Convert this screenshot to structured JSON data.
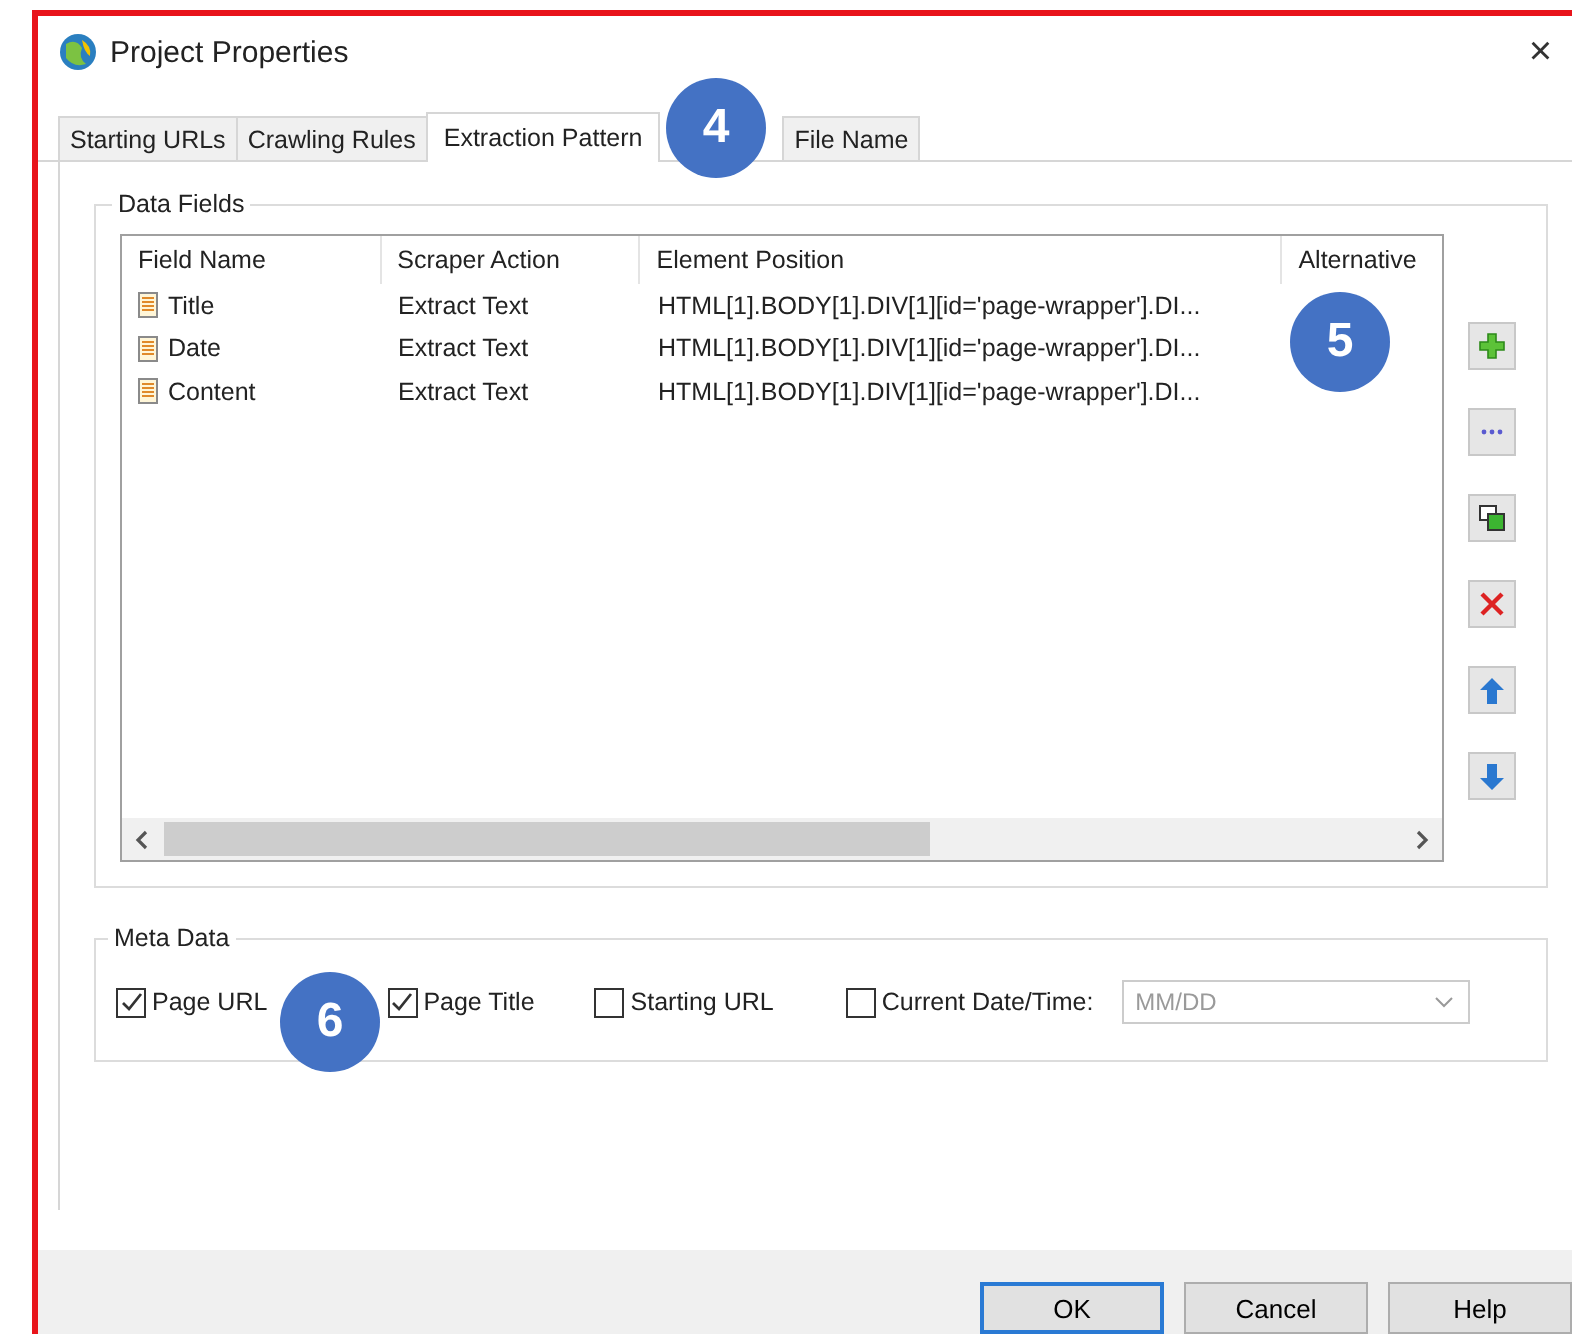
{
  "window": {
    "title": "Project Properties",
    "close": "×"
  },
  "tabs": [
    {
      "label": "Starting URLs",
      "selected": false
    },
    {
      "label": "Crawling Rules",
      "selected": false
    },
    {
      "label": "Extraction Pattern",
      "selected": true
    },
    {
      "label": "File Name",
      "selected": false
    }
  ],
  "data_fields": {
    "title": "Data Fields",
    "columns": [
      "Field Name",
      "Scraper Action",
      "Element Position",
      "Alternative"
    ],
    "rows": [
      {
        "name": "Title",
        "action": "Extract Text",
        "position": "HTML[1].BODY[1].DIV[1][id='page-wrapper'].DI..."
      },
      {
        "name": "Date",
        "action": "Extract Text",
        "position": "HTML[1].BODY[1].DIV[1][id='page-wrapper'].DI..."
      },
      {
        "name": "Content",
        "action": "Extract Text",
        "position": "HTML[1].BODY[1].DIV[1][id='page-wrapper'].DI..."
      }
    ],
    "side_buttons": [
      {
        "kind": "add"
      },
      {
        "kind": "more"
      },
      {
        "kind": "copy"
      },
      {
        "kind": "delete"
      },
      {
        "kind": "up"
      },
      {
        "kind": "down"
      }
    ]
  },
  "meta_data": {
    "title": "Meta Data",
    "options": [
      {
        "label": "Page URL",
        "checked": true
      },
      {
        "label": "Page Title",
        "checked": true
      },
      {
        "label": "Starting URL",
        "checked": false
      },
      {
        "label": "Current Date/Time:",
        "checked": false
      }
    ],
    "date_format": {
      "placeholder": "MM/DD",
      "disabled": true
    }
  },
  "buttons": [
    {
      "label": "OK",
      "default": true
    },
    {
      "label": "Cancel",
      "default": false
    },
    {
      "label": "Help",
      "default": false
    }
  ],
  "callouts": [
    "4",
    "5",
    "6"
  ]
}
